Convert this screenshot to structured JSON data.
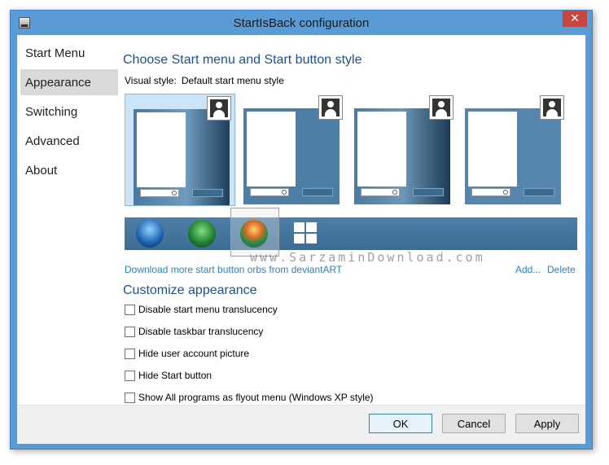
{
  "window": {
    "title": "StartIsBack configuration",
    "close_glyph": "✕"
  },
  "sidebar": {
    "items": [
      {
        "label": "Start Menu"
      },
      {
        "label": "Appearance",
        "active": true
      },
      {
        "label": "Switching"
      },
      {
        "label": "Advanced"
      },
      {
        "label": "About"
      }
    ]
  },
  "main": {
    "heading_style": "Choose Start menu and Start button style",
    "visual_style_label": "Visual style:",
    "visual_style_value": "Default start menu style",
    "style_thumbnails": [
      {
        "name": "style-1",
        "selected": true
      },
      {
        "name": "style-2",
        "selected": false
      },
      {
        "name": "style-3",
        "selected": false
      },
      {
        "name": "style-4",
        "selected": false
      }
    ],
    "orbs": [
      "windows-7-orb-icon",
      "clover-orb-icon",
      "colorful-orb-icon",
      "windows-8-logo-icon"
    ],
    "watermark": "www.SarzaminDownload.com",
    "download_link": "Download more start button orbs from deviantART",
    "add_link": "Add...",
    "delete_link": "Delete",
    "heading_customize": "Customize appearance",
    "options": [
      {
        "label": "Disable start menu translucency",
        "checked": false
      },
      {
        "label": "Disable taskbar translucency",
        "checked": false
      },
      {
        "label": "Hide user account picture",
        "checked": false
      },
      {
        "label": "Hide Start button",
        "checked": false
      },
      {
        "label": "Show All programs as flyout menu (Windows XP style)",
        "checked": false
      }
    ]
  },
  "footer": {
    "ok_label": "OK",
    "cancel_label": "Cancel",
    "apply_label": "Apply"
  },
  "colors": {
    "accent": "#1c4f9a",
    "link": "#2b7fd0",
    "frame": "#5b9bd5",
    "close": "#c7473d"
  }
}
